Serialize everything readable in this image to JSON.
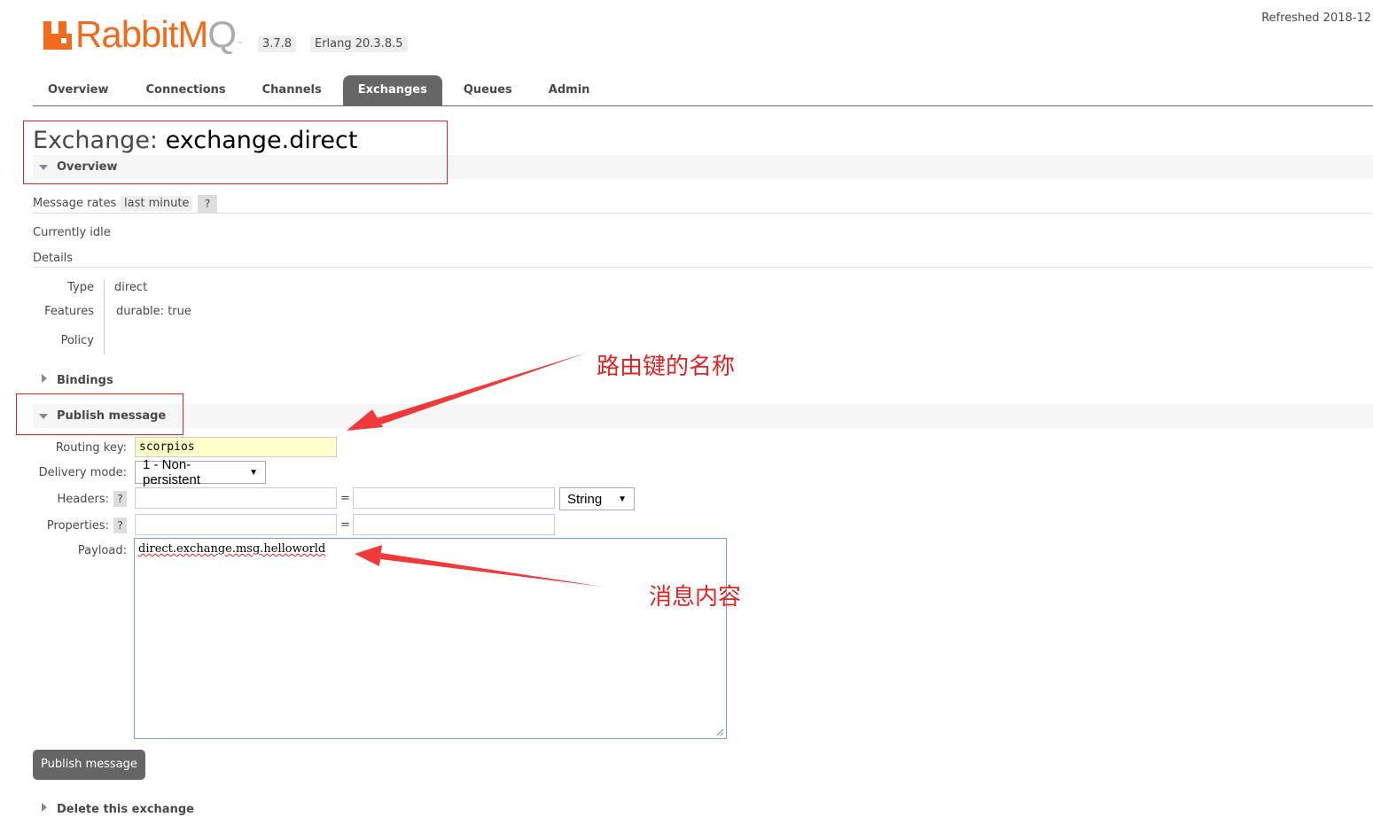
{
  "header": {
    "logo_text_a": "RabbitM",
    "logo_text_b": "Q",
    "logo_tm": "™",
    "version": "3.7.8",
    "erlang": "Erlang 20.3.8.5",
    "refreshed": "Refreshed 2018-12"
  },
  "tabs": [
    {
      "label": "Overview"
    },
    {
      "label": "Connections"
    },
    {
      "label": "Channels"
    },
    {
      "label": "Exchanges",
      "active": true
    },
    {
      "label": "Queues"
    },
    {
      "label": "Admin"
    }
  ],
  "page": {
    "title_prefix": "Exchange:",
    "title_name": "exchange.direct"
  },
  "overview": {
    "section_label": "Overview",
    "message_rates_label": "Message rates",
    "message_rates_value": "last minute",
    "help": "?",
    "idle": "Currently idle",
    "details_label": "Details",
    "type_label": "Type",
    "type_value": "direct",
    "features_label": "Features",
    "features_key": "durable:",
    "features_value": "true",
    "policy_label": "Policy"
  },
  "bindings": {
    "section_label": "Bindings"
  },
  "publish": {
    "section_label": "Publish message",
    "routing_key_label": "Routing key:",
    "routing_key_value": "scorpios",
    "delivery_mode_label": "Delivery mode:",
    "delivery_mode_value": "1 - Non-persistent",
    "headers_label": "Headers:",
    "properties_label": "Properties:",
    "help": "?",
    "equals": "=",
    "header_type_value": "String",
    "payload_label": "Payload:",
    "payload_value": "direct.exchange.msg.helloworld",
    "button_label": "Publish message"
  },
  "delete": {
    "section_label": "Delete this exchange"
  },
  "annotations": {
    "routing_key_note": "路由键的名称",
    "payload_note": "消息内容",
    "color": "#e02424"
  },
  "colors": {
    "brand": "#f26b1d",
    "tab_active": "#666666",
    "routing_input_bg": "#ffffcc"
  }
}
